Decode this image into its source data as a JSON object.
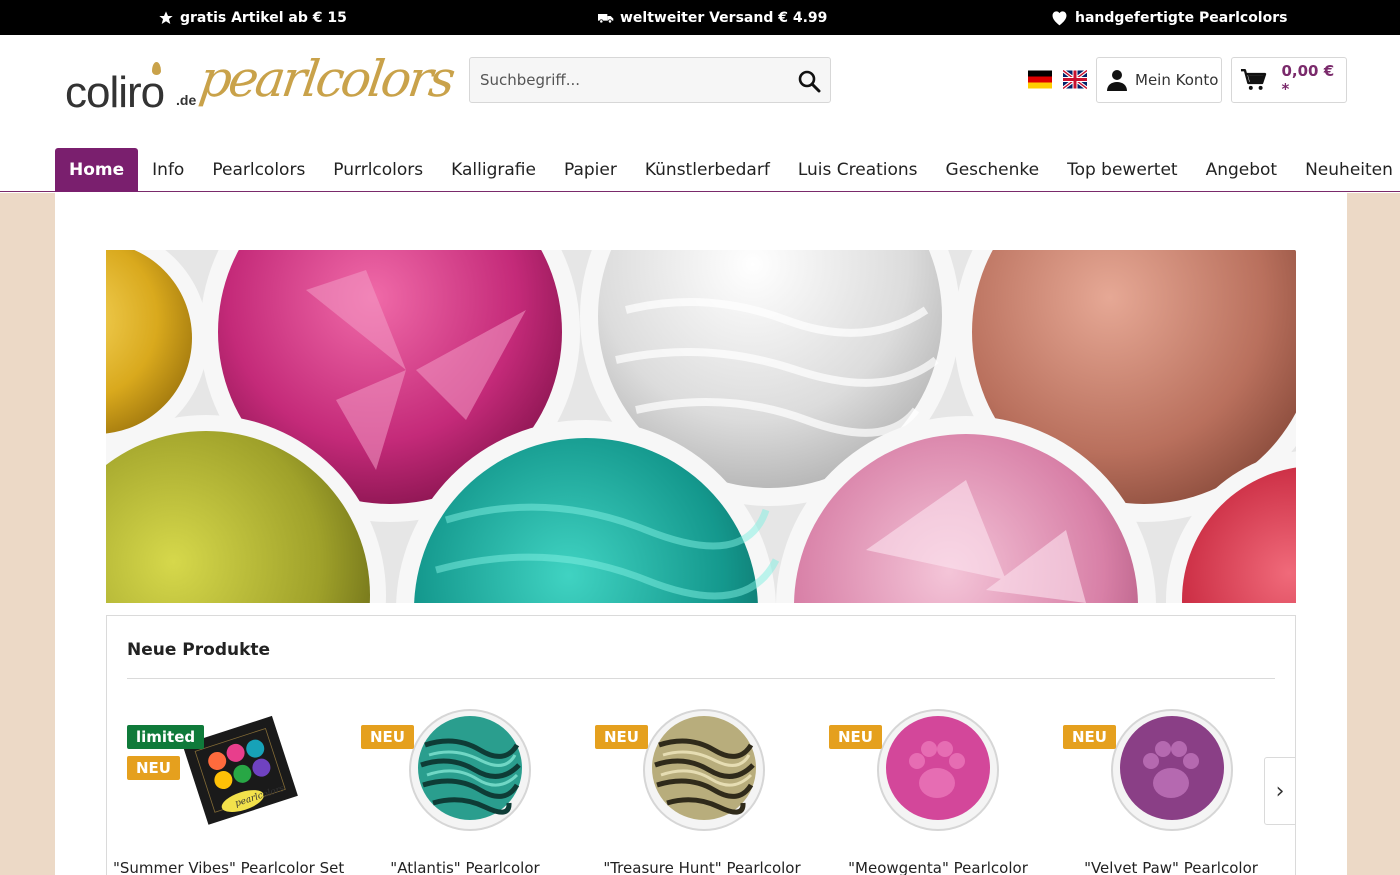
{
  "topbar": {
    "usp1": "gratis Artikel ab € 15",
    "usp2": "weltweiter Versand € 4.99",
    "usp3": "handgefertigte Pearlcolors",
    "icons": [
      "star-icon",
      "truck-icon",
      "heart-icon"
    ]
  },
  "header": {
    "logo_text": "coliro",
    "logo_domain": ".de",
    "logo_script": "pearlcolors",
    "search_placeholder": "Suchbegriff...",
    "account_label": "Mein Konto",
    "cart_total": "0,00 € *",
    "languages": [
      "de",
      "en"
    ]
  },
  "nav": {
    "items": [
      "Home",
      "Info",
      "Pearlcolors",
      "Purrlcolors",
      "Kalligrafie",
      "Papier",
      "Künstlerbedarf",
      "Luis Creations",
      "Geschenke",
      "Top bewertet",
      "Angebot",
      "Neuheiten"
    ],
    "active": "Home"
  },
  "colors": {
    "brand": "#7a1f6e",
    "badge_neu": "#e5a01e",
    "badge_limited": "#0f7a3a",
    "page_bg": "#ecd9c6",
    "logo_gold": "#c9a24a"
  },
  "products": {
    "title": "Neue Produkte",
    "items": [
      {
        "name": "\"Summer Vibes\" Pearlcolor Set",
        "badges": [
          "limited",
          "NEU"
        ]
      },
      {
        "name": "\"Atlantis\" Pearlcolor",
        "badges": [
          "NEU"
        ]
      },
      {
        "name": "\"Treasure Hunt\" Pearlcolor",
        "badges": [
          "NEU"
        ]
      },
      {
        "name": "\"Meowgenta\" Pearlcolor",
        "badges": [
          "NEU"
        ]
      },
      {
        "name": "\"Velvet Paw\" Pearlcolor",
        "badges": [
          "NEU"
        ]
      }
    ],
    "next_label": "›"
  }
}
